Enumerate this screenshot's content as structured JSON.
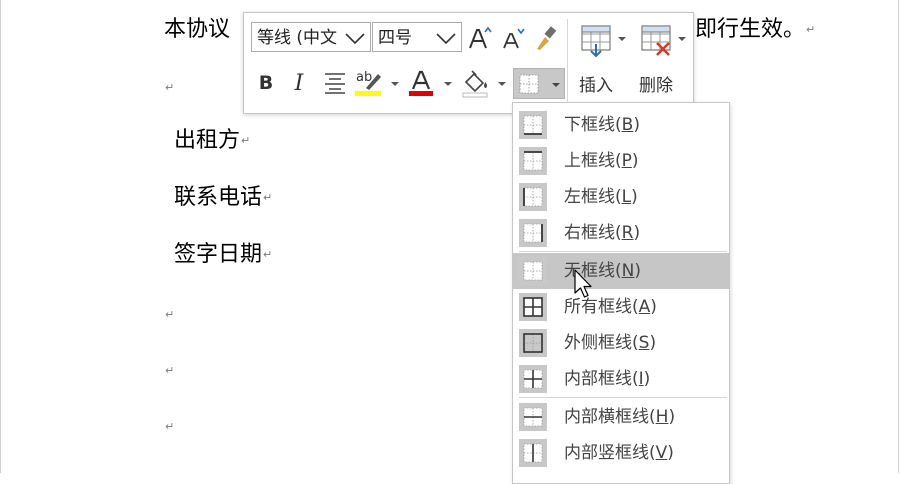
{
  "document": {
    "line1_start": "本协议",
    "line1_end": "即行生效。",
    "lessor_label": "出租方",
    "phone_label": "联系电话",
    "sign_date_label": "签字日期",
    "paragraph_mark": "↵"
  },
  "mini_toolbar": {
    "font_name": "等线 (中文",
    "font_size": "四号",
    "insert_label": "插入",
    "delete_label": "删除",
    "highlight_text": "ab",
    "highlight_color": "#ffff00",
    "font_color_letter": "A",
    "font_color": "#e00000"
  },
  "borders_menu": {
    "items": [
      {
        "label": "下框线",
        "accel": "B",
        "icon": "bottom-border-icon"
      },
      {
        "label": "上框线",
        "accel": "P",
        "icon": "top-border-icon"
      },
      {
        "label": "左框线",
        "accel": "L",
        "icon": "left-border-icon"
      },
      {
        "label": "右框线",
        "accel": "R",
        "icon": "right-border-icon"
      },
      {
        "label": "无框线",
        "accel": "N",
        "icon": "no-border-icon",
        "highlighted": true
      },
      {
        "label": "所有框线",
        "accel": "A",
        "icon": "all-borders-icon"
      },
      {
        "label": "外侧框线",
        "accel": "S",
        "icon": "outside-borders-icon"
      },
      {
        "label": "内部框线",
        "accel": "I",
        "icon": "inside-borders-icon"
      },
      {
        "label": "内部横框线",
        "accel": "H",
        "icon": "inside-horizontal-border-icon"
      },
      {
        "label": "内部竖框线",
        "accel": "V",
        "icon": "inside-vertical-border-icon"
      }
    ]
  }
}
